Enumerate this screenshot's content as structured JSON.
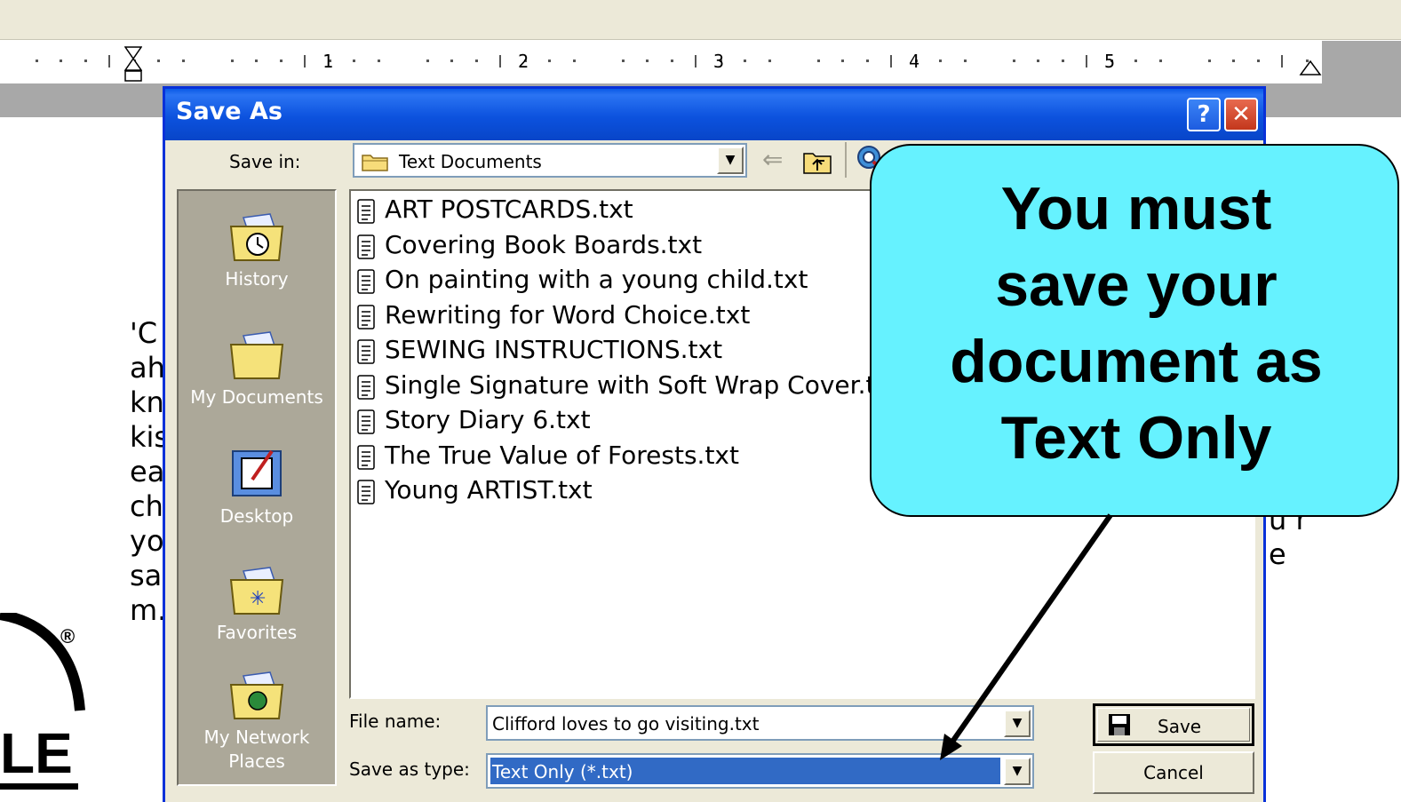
{
  "ruler": {
    "numbers": [
      "1",
      "2",
      "3",
      "4",
      "5"
    ]
  },
  "document": {
    "fragments": [
      "'C",
      "ah",
      "kn",
      "kis",
      "ea",
      "ch",
      "yo",
      "sa",
      "m.",
      "u r",
      "e"
    ],
    "logo_text": "LE",
    "logo_mark": "®"
  },
  "dialog": {
    "title": "Save As",
    "help_button": "?",
    "close_button": "✕",
    "save_in": {
      "label": "Save in:",
      "value": "Text Documents"
    },
    "places": [
      {
        "label": "History",
        "icon": "history-icon"
      },
      {
        "label": "My Documents",
        "icon": "my-documents-icon"
      },
      {
        "label": "Desktop",
        "icon": "desktop-icon"
      },
      {
        "label": "Favorites",
        "icon": "favorites-icon"
      },
      {
        "label": "My Network Places",
        "icon": "network-places-icon"
      }
    ],
    "files": [
      "ART POSTCARDS.txt",
      "Covering Book Boards.txt",
      "On painting with a young child.txt",
      "Rewriting for Word Choice.txt",
      "SEWING INSTRUCTIONS.txt",
      "Single Signature with Soft Wrap Cover.txt",
      "Story Diary 6.txt",
      "The True Value of Forests.txt",
      "Young ARTIST.txt"
    ],
    "file_name": {
      "label": "File name:",
      "value": "Clifford loves to go visiting.txt"
    },
    "save_as_type": {
      "label": "Save as type:",
      "value": "Text Only (*.txt)"
    },
    "save_button": "Save",
    "cancel_button": "Cancel"
  },
  "callout": {
    "lines": [
      "You must",
      "save your",
      "document as",
      "Text Only"
    ],
    "color": "#66f2ff"
  }
}
